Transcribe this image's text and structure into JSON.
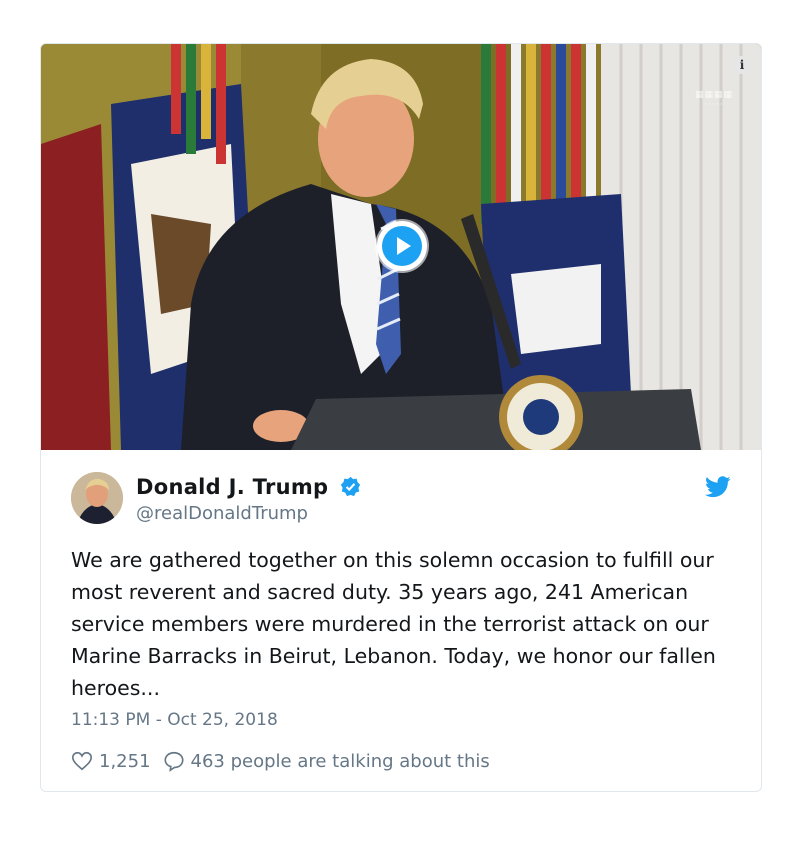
{
  "tweet": {
    "author_name": "Donald J. Trump",
    "handle": "@realDonaldTrump",
    "text": "We are gathered together on this solemn occasion to fulfill our most reverent and sacred duty. 35 years ago, 241 American service members were murdered in the terrorist attack on our Marine Barracks in Beirut, Lebanon. Today, we honor our fallen heroes...",
    "timestamp": "11:13 PM - Oct 25, 2018",
    "likes": "1,251",
    "talking": "463 people are talking about this"
  },
  "icons": {
    "info": "info-icon",
    "play": "play-icon",
    "verified": "verified-badge-icon",
    "bird": "twitter-bird-icon",
    "heart": "heart-icon",
    "reply": "speech-bubble-icon"
  },
  "colors": {
    "accent": "#1da1f2",
    "text": "#14171a",
    "secondary": "#657786",
    "border": "#e1e8ed"
  }
}
